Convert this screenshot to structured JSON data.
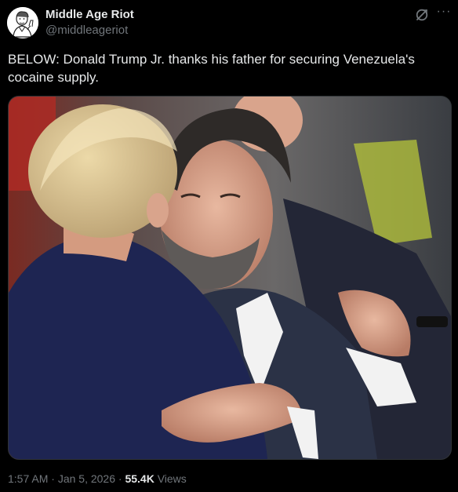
{
  "author": {
    "name": "Middle Age Riot",
    "handle": "@middleageriot",
    "avatar_icon": "sketch-portrait-avatar"
  },
  "header_icons": {
    "grok": "grok-slash-icon",
    "more": "more-horizontal-icon",
    "more_glyph": "···"
  },
  "tweet": {
    "text": "BELOW: Donald Trump Jr. thanks his father for securing Venezuela's cocaine supply.",
    "media_icon": "photo-two-men-embracing"
  },
  "meta": {
    "time": "1:57 AM",
    "separator": "·",
    "date": "Jan 5, 2026",
    "views_count": "55.4K",
    "views_label": "Views"
  },
  "colors": {
    "background": "#000000",
    "primary_text": "#e7e9ea",
    "secondary_text": "#71767b",
    "border": "#2f3336"
  }
}
